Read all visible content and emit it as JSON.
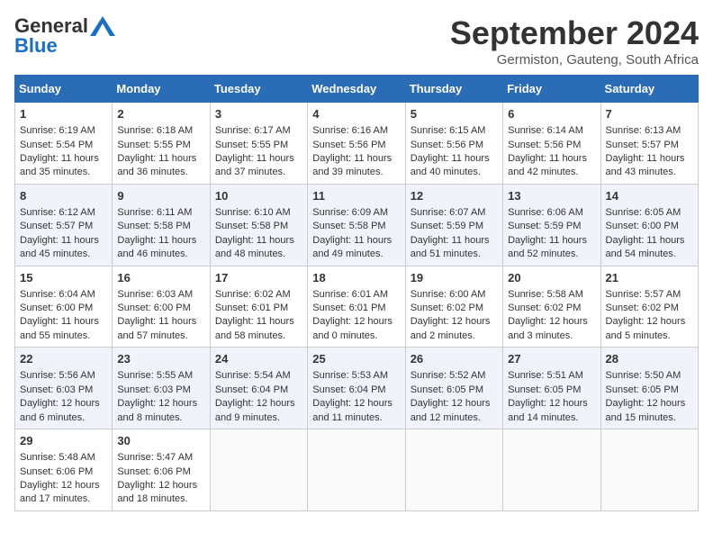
{
  "logo": {
    "general": "General",
    "blue": "Blue"
  },
  "title": "September 2024",
  "location": "Germiston, Gauteng, South Africa",
  "days": [
    "Sunday",
    "Monday",
    "Tuesday",
    "Wednesday",
    "Thursday",
    "Friday",
    "Saturday"
  ],
  "weeks": [
    [
      {
        "day": "1",
        "sunrise": "6:19 AM",
        "sunset": "5:54 PM",
        "daylight": "11 hours and 35 minutes."
      },
      {
        "day": "2",
        "sunrise": "6:18 AM",
        "sunset": "5:55 PM",
        "daylight": "11 hours and 36 minutes."
      },
      {
        "day": "3",
        "sunrise": "6:17 AM",
        "sunset": "5:55 PM",
        "daylight": "11 hours and 37 minutes."
      },
      {
        "day": "4",
        "sunrise": "6:16 AM",
        "sunset": "5:56 PM",
        "daylight": "11 hours and 39 minutes."
      },
      {
        "day": "5",
        "sunrise": "6:15 AM",
        "sunset": "5:56 PM",
        "daylight": "11 hours and 40 minutes."
      },
      {
        "day": "6",
        "sunrise": "6:14 AM",
        "sunset": "5:56 PM",
        "daylight": "11 hours and 42 minutes."
      },
      {
        "day": "7",
        "sunrise": "6:13 AM",
        "sunset": "5:57 PM",
        "daylight": "11 hours and 43 minutes."
      }
    ],
    [
      {
        "day": "8",
        "sunrise": "6:12 AM",
        "sunset": "5:57 PM",
        "daylight": "11 hours and 45 minutes."
      },
      {
        "day": "9",
        "sunrise": "6:11 AM",
        "sunset": "5:58 PM",
        "daylight": "11 hours and 46 minutes."
      },
      {
        "day": "10",
        "sunrise": "6:10 AM",
        "sunset": "5:58 PM",
        "daylight": "11 hours and 48 minutes."
      },
      {
        "day": "11",
        "sunrise": "6:09 AM",
        "sunset": "5:58 PM",
        "daylight": "11 hours and 49 minutes."
      },
      {
        "day": "12",
        "sunrise": "6:07 AM",
        "sunset": "5:59 PM",
        "daylight": "11 hours and 51 minutes."
      },
      {
        "day": "13",
        "sunrise": "6:06 AM",
        "sunset": "5:59 PM",
        "daylight": "11 hours and 52 minutes."
      },
      {
        "day": "14",
        "sunrise": "6:05 AM",
        "sunset": "6:00 PM",
        "daylight": "11 hours and 54 minutes."
      }
    ],
    [
      {
        "day": "15",
        "sunrise": "6:04 AM",
        "sunset": "6:00 PM",
        "daylight": "11 hours and 55 minutes."
      },
      {
        "day": "16",
        "sunrise": "6:03 AM",
        "sunset": "6:00 PM",
        "daylight": "11 hours and 57 minutes."
      },
      {
        "day": "17",
        "sunrise": "6:02 AM",
        "sunset": "6:01 PM",
        "daylight": "11 hours and 58 minutes."
      },
      {
        "day": "18",
        "sunrise": "6:01 AM",
        "sunset": "6:01 PM",
        "daylight": "12 hours and 0 minutes."
      },
      {
        "day": "19",
        "sunrise": "6:00 AM",
        "sunset": "6:02 PM",
        "daylight": "12 hours and 2 minutes."
      },
      {
        "day": "20",
        "sunrise": "5:58 AM",
        "sunset": "6:02 PM",
        "daylight": "12 hours and 3 minutes."
      },
      {
        "day": "21",
        "sunrise": "5:57 AM",
        "sunset": "6:02 PM",
        "daylight": "12 hours and 5 minutes."
      }
    ],
    [
      {
        "day": "22",
        "sunrise": "5:56 AM",
        "sunset": "6:03 PM",
        "daylight": "12 hours and 6 minutes."
      },
      {
        "day": "23",
        "sunrise": "5:55 AM",
        "sunset": "6:03 PM",
        "daylight": "12 hours and 8 minutes."
      },
      {
        "day": "24",
        "sunrise": "5:54 AM",
        "sunset": "6:04 PM",
        "daylight": "12 hours and 9 minutes."
      },
      {
        "day": "25",
        "sunrise": "5:53 AM",
        "sunset": "6:04 PM",
        "daylight": "12 hours and 11 minutes."
      },
      {
        "day": "26",
        "sunrise": "5:52 AM",
        "sunset": "6:05 PM",
        "daylight": "12 hours and 12 minutes."
      },
      {
        "day": "27",
        "sunrise": "5:51 AM",
        "sunset": "6:05 PM",
        "daylight": "12 hours and 14 minutes."
      },
      {
        "day": "28",
        "sunrise": "5:50 AM",
        "sunset": "6:05 PM",
        "daylight": "12 hours and 15 minutes."
      }
    ],
    [
      {
        "day": "29",
        "sunrise": "5:48 AM",
        "sunset": "6:06 PM",
        "daylight": "12 hours and 17 minutes."
      },
      {
        "day": "30",
        "sunrise": "5:47 AM",
        "sunset": "6:06 PM",
        "daylight": "12 hours and 18 minutes."
      },
      null,
      null,
      null,
      null,
      null
    ]
  ],
  "labels": {
    "sunrise": "Sunrise:",
    "sunset": "Sunset:",
    "daylight": "Daylight:"
  }
}
